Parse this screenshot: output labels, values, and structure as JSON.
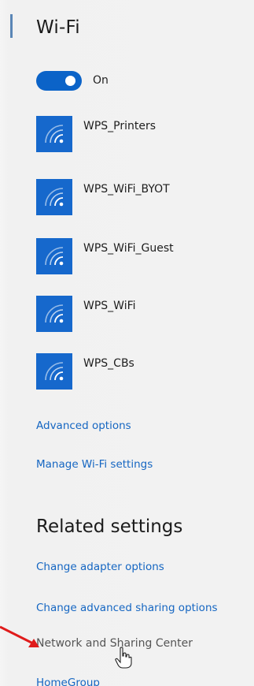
{
  "header": {
    "title": "Wi-Fi"
  },
  "wifi_toggle": {
    "state_label": "On",
    "on": true
  },
  "networks": [
    {
      "name": "WPS_Printers",
      "icon": "wifi-signal-icon"
    },
    {
      "name": "WPS_WiFi_BYOT",
      "icon": "wifi-signal-icon"
    },
    {
      "name": "WPS_WiFi_Guest",
      "icon": "wifi-signal-icon"
    },
    {
      "name": "WPS_WiFi",
      "icon": "wifi-signal-icon"
    },
    {
      "name": "WPS_CBs",
      "icon": "wifi-signal-icon"
    }
  ],
  "links": {
    "advanced_options": "Advanced options",
    "manage_wifi": "Manage Wi-Fi settings"
  },
  "related": {
    "title": "Related settings",
    "change_adapter": "Change adapter options",
    "change_sharing": "Change advanced sharing options",
    "network_center": "Network and Sharing Center",
    "homegroup": "HomeGroup"
  },
  "colors": {
    "accent": "#1668cc",
    "link": "#1566c2",
    "annotation_arrow": "#e01b1b"
  }
}
